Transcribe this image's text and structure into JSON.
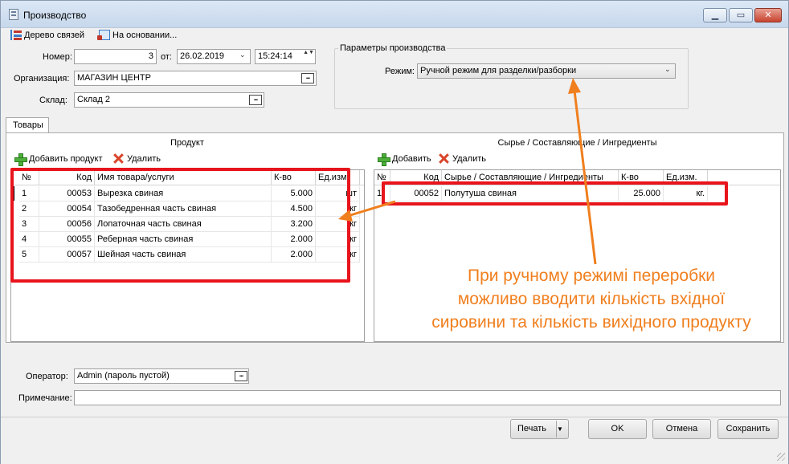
{
  "window": {
    "title": "Производство",
    "minimize_glyph": "▁",
    "maximize_glyph": "▭",
    "close_glyph": "✕"
  },
  "toolbar": {
    "tree_label": "Дерево связей",
    "based_on_label": "На основании..."
  },
  "form": {
    "number_label": "Номер:",
    "number_value": "3",
    "from_label": "от:",
    "date_value": "26.02.2019",
    "time_value": "15:24:14",
    "org_label": "Организация:",
    "org_value": "МАГАЗИН ЦЕНТР",
    "warehouse_label": "Склад:",
    "warehouse_value": "Склад 2",
    "browse_glyph": "...",
    "spin_glyph": "▲▼",
    "dropdown_glyph": "⌄"
  },
  "params": {
    "title": "Параметры производства",
    "mode_label": "Режим:",
    "mode_value": "Ручной режим для разделки/разборки"
  },
  "tabs": [
    {
      "label": "Товары"
    }
  ],
  "product": {
    "title": "Продукт",
    "add_label": "Добавить продукт",
    "delete_label": "Удалить",
    "columns": [
      "№",
      "Код",
      "Имя товара/услуги",
      "К-во",
      "Ед.изм."
    ],
    "rows": [
      {
        "n": "1",
        "code": "00053",
        "name": "Вырезка свиная",
        "qty": "5.000",
        "unit": "шт"
      },
      {
        "n": "2",
        "code": "00054",
        "name": "Тазобедренная часть свиная",
        "qty": "4.500",
        "unit": "кг"
      },
      {
        "n": "3",
        "code": "00056",
        "name": "Лопаточная часть свиная",
        "qty": "3.200",
        "unit": "кг"
      },
      {
        "n": "4",
        "code": "00055",
        "name": "Реберная часть свиная",
        "qty": "2.000",
        "unit": "кг"
      },
      {
        "n": "5",
        "code": "00057",
        "name": "Шейная часть свиная",
        "qty": "2.000",
        "unit": "кг"
      }
    ]
  },
  "materials": {
    "title": "Сырье / Составляющие / Ингредиенты",
    "add_label": "Добавить",
    "delete_label": "Удалить",
    "columns": [
      "№",
      "Код",
      "Сырье / Составляющие / Ингредиенты",
      "К-во",
      "Ед.изм."
    ],
    "rows": [
      {
        "n": "1",
        "code": "00052",
        "name": "Полутуша свиная",
        "qty": "25.000",
        "unit": "кг."
      }
    ]
  },
  "annotation": {
    "lines": [
      "При ручному режимі переробки",
      "можливо вводити кількість вхідної",
      "сировини та кількість вихідного продукту"
    ],
    "color": "#f07f1e",
    "highlight_color": "#e8141c"
  },
  "footer": {
    "operator_label": "Оператор:",
    "operator_value": "Admin (пароль пустой)",
    "note_label": "Примечание:",
    "note_value": ""
  },
  "buttons": {
    "print": "Печать",
    "print_split_glyph": "▼",
    "ok": "OK",
    "cancel": "Отмена",
    "save": "Сохранить"
  }
}
